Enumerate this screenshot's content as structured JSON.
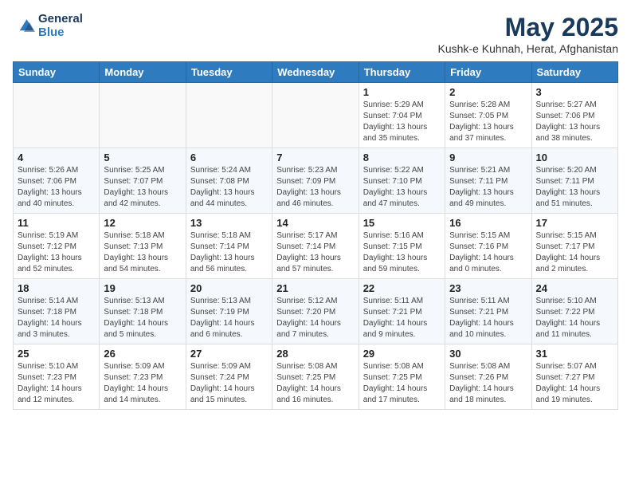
{
  "logo": {
    "general": "General",
    "blue": "Blue"
  },
  "header": {
    "title": "May 2025",
    "subtitle": "Kushk-e Kuhnah, Herat, Afghanistan"
  },
  "weekdays": [
    "Sunday",
    "Monday",
    "Tuesday",
    "Wednesday",
    "Thursday",
    "Friday",
    "Saturday"
  ],
  "weeks": [
    [
      {
        "day": "",
        "info": ""
      },
      {
        "day": "",
        "info": ""
      },
      {
        "day": "",
        "info": ""
      },
      {
        "day": "",
        "info": ""
      },
      {
        "day": "1",
        "info": "Sunrise: 5:29 AM\nSunset: 7:04 PM\nDaylight: 13 hours\nand 35 minutes."
      },
      {
        "day": "2",
        "info": "Sunrise: 5:28 AM\nSunset: 7:05 PM\nDaylight: 13 hours\nand 37 minutes."
      },
      {
        "day": "3",
        "info": "Sunrise: 5:27 AM\nSunset: 7:06 PM\nDaylight: 13 hours\nand 38 minutes."
      }
    ],
    [
      {
        "day": "4",
        "info": "Sunrise: 5:26 AM\nSunset: 7:06 PM\nDaylight: 13 hours\nand 40 minutes."
      },
      {
        "day": "5",
        "info": "Sunrise: 5:25 AM\nSunset: 7:07 PM\nDaylight: 13 hours\nand 42 minutes."
      },
      {
        "day": "6",
        "info": "Sunrise: 5:24 AM\nSunset: 7:08 PM\nDaylight: 13 hours\nand 44 minutes."
      },
      {
        "day": "7",
        "info": "Sunrise: 5:23 AM\nSunset: 7:09 PM\nDaylight: 13 hours\nand 46 minutes."
      },
      {
        "day": "8",
        "info": "Sunrise: 5:22 AM\nSunset: 7:10 PM\nDaylight: 13 hours\nand 47 minutes."
      },
      {
        "day": "9",
        "info": "Sunrise: 5:21 AM\nSunset: 7:11 PM\nDaylight: 13 hours\nand 49 minutes."
      },
      {
        "day": "10",
        "info": "Sunrise: 5:20 AM\nSunset: 7:11 PM\nDaylight: 13 hours\nand 51 minutes."
      }
    ],
    [
      {
        "day": "11",
        "info": "Sunrise: 5:19 AM\nSunset: 7:12 PM\nDaylight: 13 hours\nand 52 minutes."
      },
      {
        "day": "12",
        "info": "Sunrise: 5:18 AM\nSunset: 7:13 PM\nDaylight: 13 hours\nand 54 minutes."
      },
      {
        "day": "13",
        "info": "Sunrise: 5:18 AM\nSunset: 7:14 PM\nDaylight: 13 hours\nand 56 minutes."
      },
      {
        "day": "14",
        "info": "Sunrise: 5:17 AM\nSunset: 7:14 PM\nDaylight: 13 hours\nand 57 minutes."
      },
      {
        "day": "15",
        "info": "Sunrise: 5:16 AM\nSunset: 7:15 PM\nDaylight: 13 hours\nand 59 minutes."
      },
      {
        "day": "16",
        "info": "Sunrise: 5:15 AM\nSunset: 7:16 PM\nDaylight: 14 hours\nand 0 minutes."
      },
      {
        "day": "17",
        "info": "Sunrise: 5:15 AM\nSunset: 7:17 PM\nDaylight: 14 hours\nand 2 minutes."
      }
    ],
    [
      {
        "day": "18",
        "info": "Sunrise: 5:14 AM\nSunset: 7:18 PM\nDaylight: 14 hours\nand 3 minutes."
      },
      {
        "day": "19",
        "info": "Sunrise: 5:13 AM\nSunset: 7:18 PM\nDaylight: 14 hours\nand 5 minutes."
      },
      {
        "day": "20",
        "info": "Sunrise: 5:13 AM\nSunset: 7:19 PM\nDaylight: 14 hours\nand 6 minutes."
      },
      {
        "day": "21",
        "info": "Sunrise: 5:12 AM\nSunset: 7:20 PM\nDaylight: 14 hours\nand 7 minutes."
      },
      {
        "day": "22",
        "info": "Sunrise: 5:11 AM\nSunset: 7:21 PM\nDaylight: 14 hours\nand 9 minutes."
      },
      {
        "day": "23",
        "info": "Sunrise: 5:11 AM\nSunset: 7:21 PM\nDaylight: 14 hours\nand 10 minutes."
      },
      {
        "day": "24",
        "info": "Sunrise: 5:10 AM\nSunset: 7:22 PM\nDaylight: 14 hours\nand 11 minutes."
      }
    ],
    [
      {
        "day": "25",
        "info": "Sunrise: 5:10 AM\nSunset: 7:23 PM\nDaylight: 14 hours\nand 12 minutes."
      },
      {
        "day": "26",
        "info": "Sunrise: 5:09 AM\nSunset: 7:23 PM\nDaylight: 14 hours\nand 14 minutes."
      },
      {
        "day": "27",
        "info": "Sunrise: 5:09 AM\nSunset: 7:24 PM\nDaylight: 14 hours\nand 15 minutes."
      },
      {
        "day": "28",
        "info": "Sunrise: 5:08 AM\nSunset: 7:25 PM\nDaylight: 14 hours\nand 16 minutes."
      },
      {
        "day": "29",
        "info": "Sunrise: 5:08 AM\nSunset: 7:25 PM\nDaylight: 14 hours\nand 17 minutes."
      },
      {
        "day": "30",
        "info": "Sunrise: 5:08 AM\nSunset: 7:26 PM\nDaylight: 14 hours\nand 18 minutes."
      },
      {
        "day": "31",
        "info": "Sunrise: 5:07 AM\nSunset: 7:27 PM\nDaylight: 14 hours\nand 19 minutes."
      }
    ]
  ]
}
